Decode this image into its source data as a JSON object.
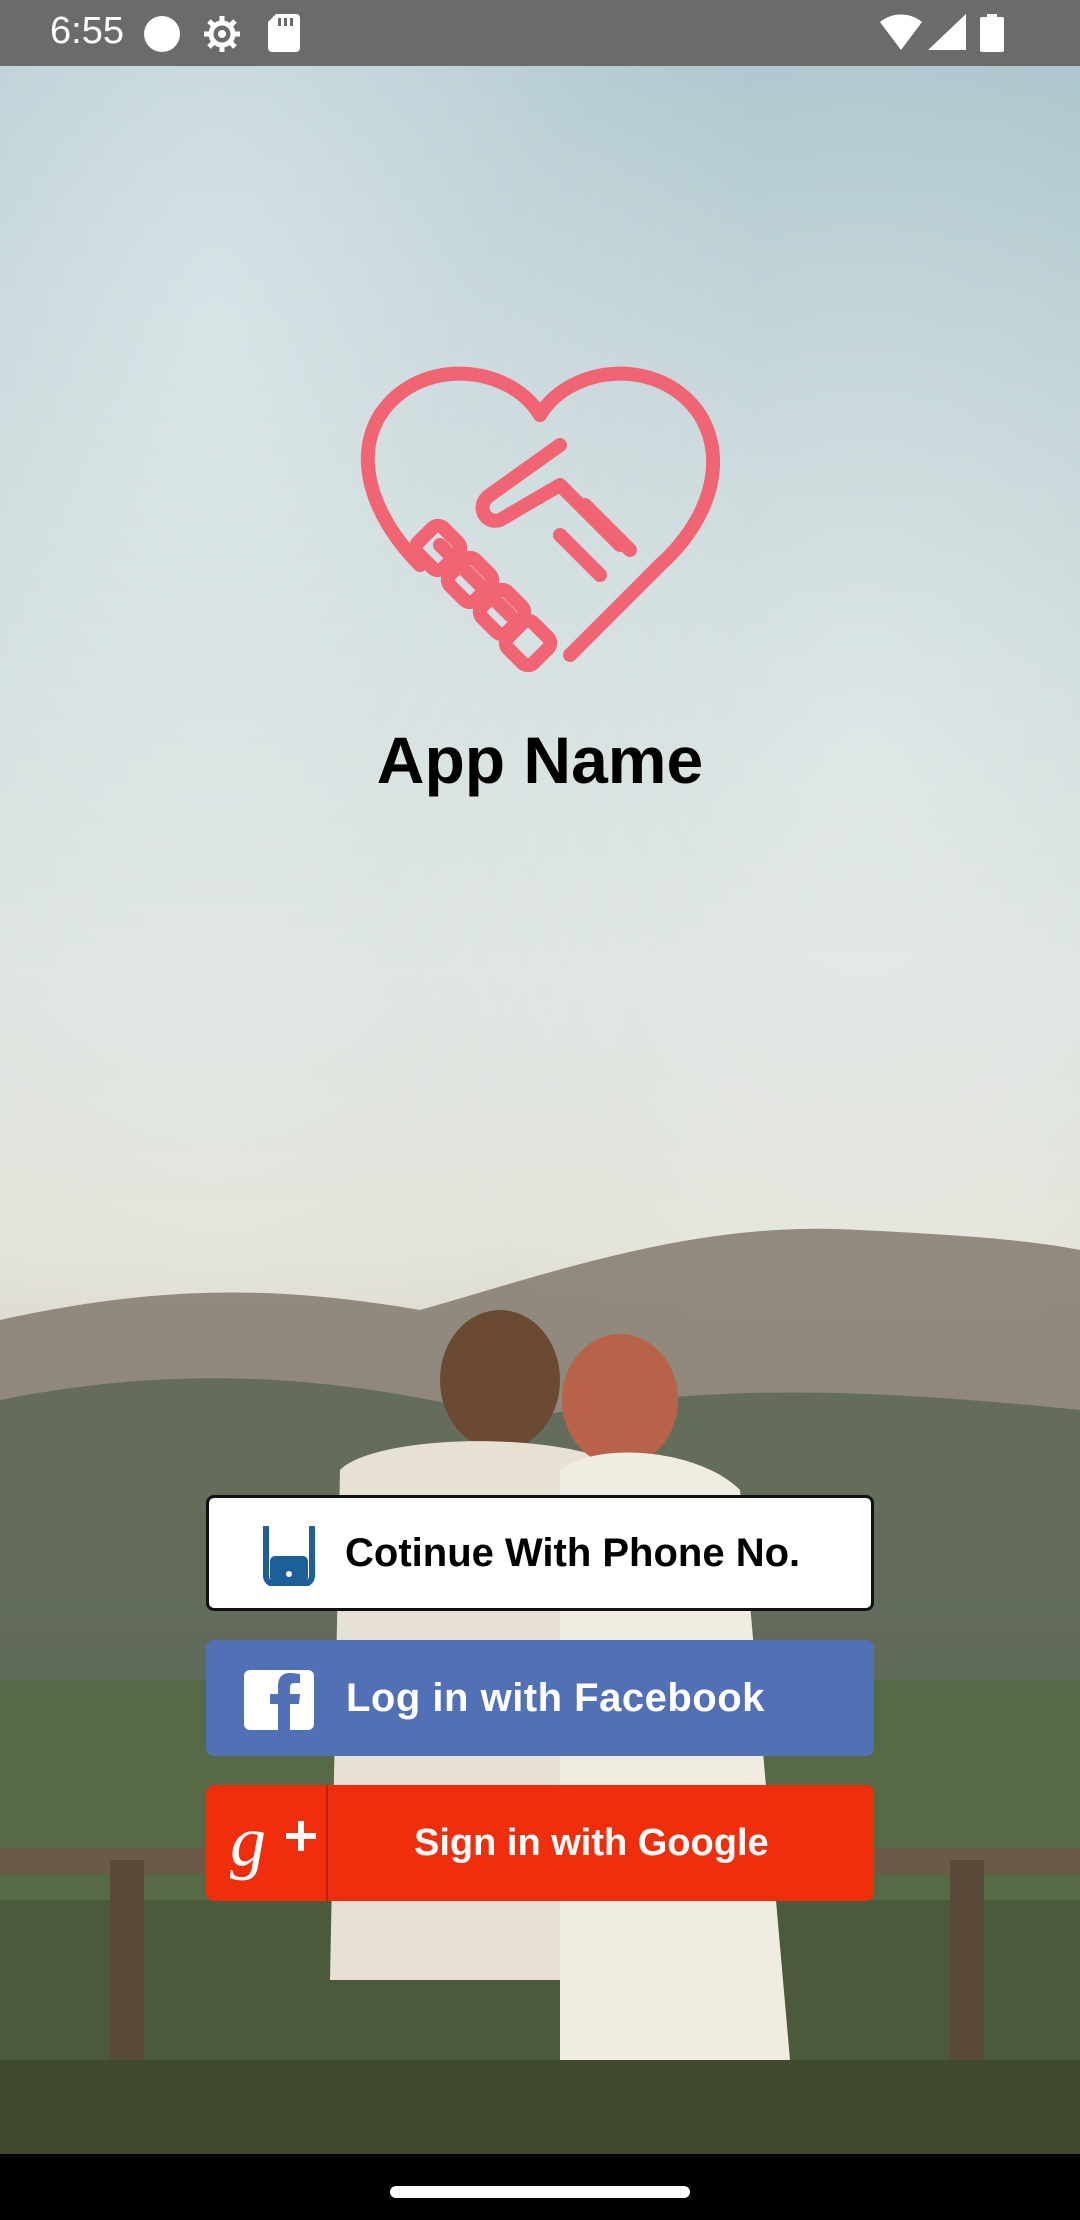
{
  "status_bar": {
    "time": "6:55",
    "icons": [
      "circle-icon",
      "settings-gear-icon",
      "sd-card-icon",
      "wifi-icon",
      "signal-icon",
      "battery-icon"
    ]
  },
  "app": {
    "name": "App Name",
    "logo_icon": "heart-handshake-icon",
    "logo_color": "#f06474"
  },
  "buttons": {
    "phone": {
      "label": "Cotinue With Phone No.",
      "icon": "phone-icon"
    },
    "facebook": {
      "label": "Log in with Facebook",
      "icon": "facebook-icon",
      "color": "#5270b6"
    },
    "google": {
      "label": "Sign in with Google",
      "icon": "google-plus-icon",
      "color": "#f12e0c"
    }
  }
}
